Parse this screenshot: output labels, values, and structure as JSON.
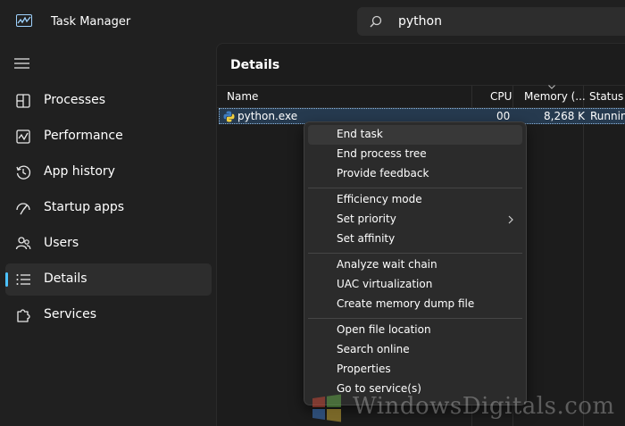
{
  "app": {
    "title": "Task Manager",
    "icon": "performance-chart-icon"
  },
  "search": {
    "value": "python",
    "icon": "search-icon"
  },
  "sidebar": {
    "menu_icon": "hamburger-icon",
    "items": [
      {
        "label": "Processes",
        "icon": "processes-grid-icon",
        "active": false
      },
      {
        "label": "Performance",
        "icon": "performance-graph-icon",
        "active": false
      },
      {
        "label": "App history",
        "icon": "history-clock-icon",
        "active": false
      },
      {
        "label": "Startup apps",
        "icon": "startup-gauge-icon",
        "active": false
      },
      {
        "label": "Users",
        "icon": "users-icon",
        "active": false
      },
      {
        "label": "Details",
        "icon": "details-list-icon",
        "active": true
      },
      {
        "label": "Services",
        "icon": "services-puzzle-icon",
        "active": false
      }
    ]
  },
  "main": {
    "title": "Details",
    "columns": {
      "name": "Name",
      "cpu": "CPU",
      "memory": "Memory (...",
      "status": "Status"
    },
    "rows": [
      {
        "name": "python.exe",
        "cpu": "00",
        "memory": "8,268 K",
        "status": "Runnin",
        "icon": "python-icon"
      }
    ]
  },
  "context_menu": {
    "groups": [
      [
        "End task",
        "End process tree",
        "Provide feedback"
      ],
      [
        "Efficiency mode",
        "Set priority",
        "Set affinity"
      ],
      [
        "Analyze wait chain",
        "UAC virtualization",
        "Create memory dump file"
      ],
      [
        "Open file location",
        "Search online",
        "Properties",
        "Go to service(s)"
      ]
    ],
    "hovered": "End task",
    "submenu_item": "Set priority"
  },
  "watermark": {
    "text": "WindowsDigitals.com"
  },
  "colors": {
    "background": "#202020",
    "panel": "#1c1c1c",
    "accent": "#4cc2ff",
    "selection": "#263a4f",
    "menu": "#2b2b2b"
  }
}
